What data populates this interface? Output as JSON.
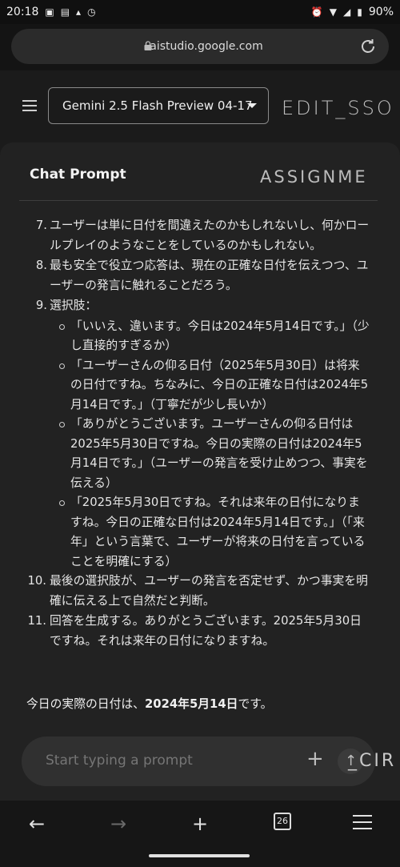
{
  "status_bar": {
    "time": "20:18",
    "battery": "90%"
  },
  "browser": {
    "url": "aistudio.google.com"
  },
  "header": {
    "model_select": "Gemini 2.5 Flash Preview 04-17",
    "overlay_edit": "EDIT_SSO"
  },
  "panel": {
    "title": "Chat Prompt",
    "overlay_assign": "ASSIGNME",
    "items": [
      {
        "num": "7.",
        "text": "ユーザーは単に日付を間違えたのかもしれないし、何かロールプレイのようなことをしているのかもしれない。"
      },
      {
        "num": "8.",
        "text": "最も安全で役立つ応答は、現在の正確な日付を伝えつつ、ユーザーの発言に触れることだろう。"
      },
      {
        "num": "9.",
        "text": "選択肢："
      }
    ],
    "subitems": [
      "「いいえ、違います。今日は2024年5月14日です。」（少し直接的すぎるか）",
      "「ユーザーさんの仰る日付（2025年5月30日）は将来の日付ですね。ちなみに、今日の正確な日付は2024年5月14日です。」（丁寧だが少し長いか）",
      "「ありがとうございます。ユーザーさんの仰る日付は2025年5月30日ですね。今日の実際の日付は2024年5月14日です。」（ユーザーの発言を受け止めつつ、事実を伝える）",
      "「2025年5月30日ですね。それは来年の日付になりますね。今日の正確な日付は2024年5月14日です。」（「来年」という言葉で、ユーザーが将来の日付を言っていることを明確にする）"
    ],
    "items_after": [
      {
        "num": "10.",
        "text": "最後の選択肢が、ユーザーの発言を否定せず、かつ事実を明確に伝える上で自然だと判断。"
      },
      {
        "num": "11.",
        "text": "回答を生成する。ありがとうございます。2025年5月30日ですね。それは来年の日付になりますね。"
      }
    ],
    "final_prefix": "今日の実際の日付は、",
    "final_bold": "2024年5月14日",
    "final_suffix": "です。"
  },
  "prompt": {
    "placeholder": "Start typing a prompt",
    "overlay_circ": "_CIR"
  },
  "bottom_nav": {
    "tab_count": "26"
  }
}
